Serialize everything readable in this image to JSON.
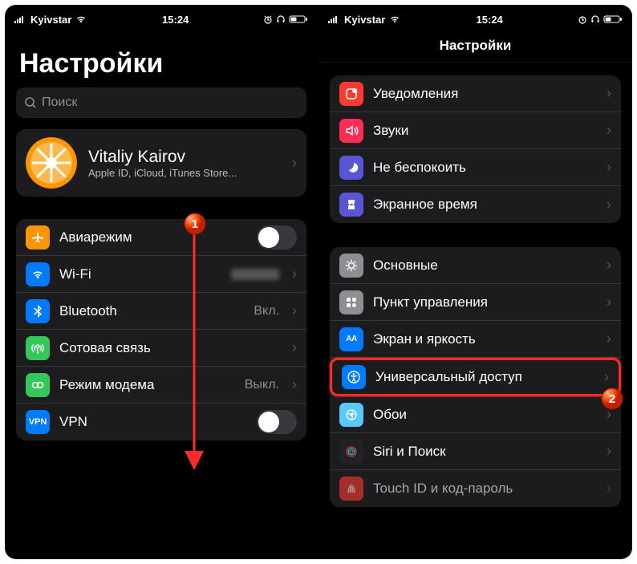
{
  "statusbar": {
    "carrier": "Kyivstar",
    "time": "15:24"
  },
  "left": {
    "title": "Настройки",
    "search_placeholder": "Поиск",
    "profile": {
      "name": "Vitaliy Kairov",
      "sub": "Apple ID, iCloud, iTunes Store..."
    },
    "rows": {
      "airplane": "Авиарежим",
      "wifi": "Wi-Fi",
      "bluetooth": "Bluetooth",
      "bluetooth_detail": "Вкл.",
      "cellular": "Сотовая связь",
      "hotspot": "Режим модема",
      "hotspot_detail": "Выкл.",
      "vpn": "VPN"
    }
  },
  "right": {
    "title": "Настройки",
    "rows": {
      "notifications": "Уведомления",
      "sounds": "Звуки",
      "dnd": "Не беспокоить",
      "screentime": "Экранное время",
      "general": "Основные",
      "control": "Пункт управления",
      "display": "Экран и яркость",
      "accessibility": "Универсальный доступ",
      "wallpaper": "Обои",
      "siri": "Siri и Поиск",
      "touchid": "Touch ID и код-пароль"
    }
  },
  "annotations": {
    "badge1": "1",
    "badge2": "2"
  },
  "colors": {
    "orange": "#ff9500",
    "blue": "#007aff",
    "green": "#34c759",
    "red": "#ff3b30",
    "purple": "#5856d6",
    "gray": "#8e8e93",
    "lightblue": "#5ac8fa"
  }
}
